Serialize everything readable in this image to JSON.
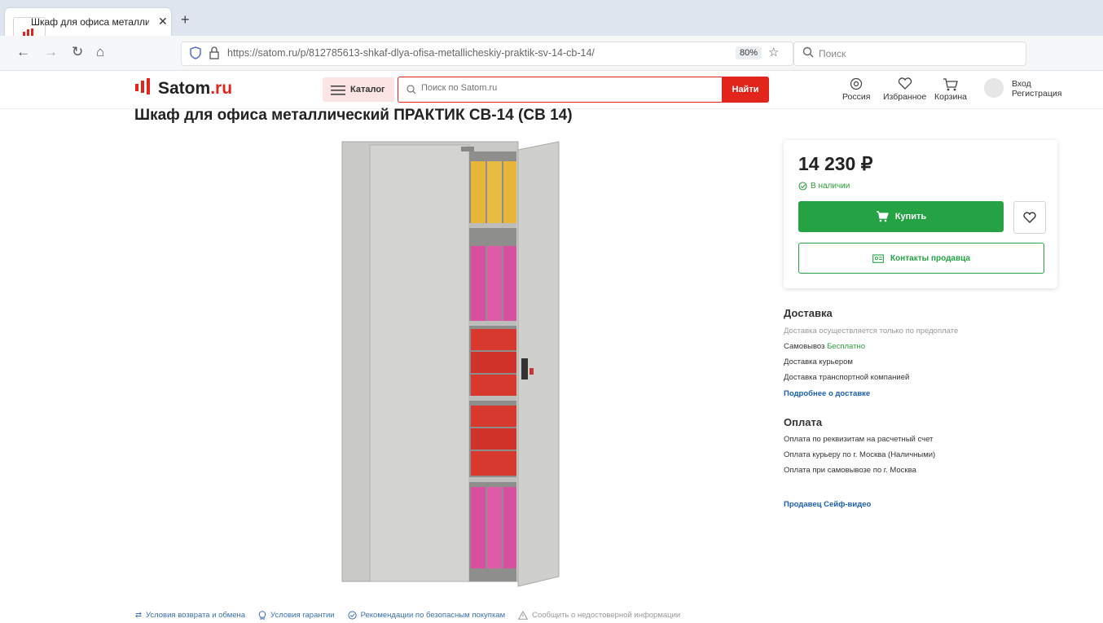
{
  "browser": {
    "tab_title": "Шкаф для офиса металлическ",
    "url": "https://satom.ru/p/812785613-shkaf-dlya-ofisa-metallicheskiy-praktik-sv-14-cb-14/",
    "zoom": "80%",
    "search_placeholder": "Поиск"
  },
  "header": {
    "logo_main": "Satom",
    "logo_tld": ".ru",
    "catalog_label": "Каталог",
    "search_placeholder": "Поиск по Satom.ru",
    "search_button": "Найти",
    "region": "Россия",
    "favorites": "Избранное",
    "cart": "Корзина",
    "login": "Вход",
    "register": "Регистрация"
  },
  "product": {
    "title": "Шкаф для офиса металлический ПРАКТИК СВ-14 (СВ 14)",
    "price": "14 230 ₽",
    "stock": "В наличии",
    "buy_label": "Купить",
    "contacts_label": "Контакты продавца"
  },
  "delivery": {
    "heading": "Доставка",
    "note": "Доставка осуществляется только по предоплате",
    "pickup_label": "Самовывоз",
    "pickup_value": "Бесплатно",
    "courier": "Доставка курьером",
    "transport": "Доставка транспортной компанией",
    "more_link": "Подробнее о доставке"
  },
  "payment": {
    "heading": "Оплата",
    "items": [
      "Оплата по реквизитам на расчетный счет",
      "Оплата курьеру по г. Москва (Наличными)",
      "Оплата при самовывозе по г. Москва"
    ],
    "seller_link": "Продавец Сейф-видео"
  },
  "footer": {
    "returns": "Условия возврата и обмена",
    "warranty": "Условия гарантии",
    "safe_buying": "Рекомендации по безопасным покупкам",
    "report": "Сообщить о недостоверной информации"
  },
  "colors": {
    "brand_red": "#e1251b",
    "buy_green": "#25a243"
  }
}
